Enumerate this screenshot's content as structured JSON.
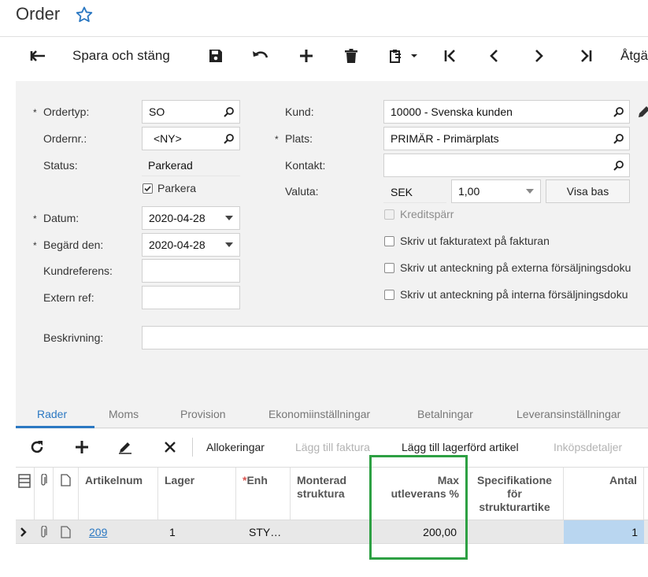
{
  "page": {
    "title": "Order"
  },
  "toolbar": {
    "save_close": "Spara och stäng",
    "actions": "Åtgä"
  },
  "form": {
    "ordertyp": {
      "label": "Ordertyp:",
      "value": "SO"
    },
    "ordernr": {
      "label": "Ordernr.:",
      "value": "<NY>"
    },
    "status": {
      "label": "Status:",
      "value": "Parkerad"
    },
    "parkera": {
      "label": "Parkera",
      "checked": true
    },
    "datum": {
      "label": "Datum:",
      "value": "2020-04-28"
    },
    "begard": {
      "label": "Begärd den:",
      "value": "2020-04-28"
    },
    "kundreferens": {
      "label": "Kundreferens:",
      "value": ""
    },
    "externref": {
      "label": "Extern ref:",
      "value": ""
    },
    "beskrivning": {
      "label": "Beskrivning:",
      "value": ""
    },
    "kund": {
      "label": "Kund:",
      "value": "10000 - Svenska kunden"
    },
    "plats": {
      "label": "Plats:",
      "value": "PRIMÄR - Primärplats"
    },
    "kontakt": {
      "label": "Kontakt:",
      "value": ""
    },
    "valuta": {
      "label": "Valuta:",
      "currency": "SEK",
      "rate": "1,00",
      "button": "Visa bas"
    },
    "kreditsparr": {
      "label": "Kreditspärr",
      "checked": false
    },
    "skriv_faktura": {
      "label": "Skriv ut fakturatext på fakturan",
      "checked": false
    },
    "skriv_extern": {
      "label": "Skriv ut anteckning på externa försäljningsdoku",
      "checked": false
    },
    "skriv_intern": {
      "label": "Skriv ut anteckning på interna försäljningsdoku",
      "checked": false
    }
  },
  "tabs": [
    "Rader",
    "Moms",
    "Provision",
    "Ekonomiinställningar",
    "Betalningar",
    "Leveransinställningar"
  ],
  "grid_toolbar": {
    "allokeringar": "Allokeringar",
    "lagg_faktura": "Lägg till faktura",
    "lagg_lager": "Lägg till lagerförd artikel",
    "inkop": "Inköpsdetaljer"
  },
  "grid": {
    "headers": {
      "artikel": "Artikelnum",
      "lager": "Lager",
      "enh_star": "*",
      "enh": "Enh",
      "monterad1": "Monterad",
      "monterad2": "struktura",
      "max1": "Max",
      "max2": "utleverans %",
      "spec1": "Specifikatione",
      "spec2": "för",
      "spec3": "strukturartike",
      "antal": "Antal"
    },
    "rows": [
      {
        "artikel": "209",
        "lager": "1",
        "enh": "STY…",
        "monterad": "",
        "max": "200,00",
        "spec": "",
        "antal": "1"
      }
    ]
  },
  "colors": {
    "accent": "#2b78c2",
    "highlight": "#2da043",
    "selected_cell": "#b9d6f0"
  }
}
